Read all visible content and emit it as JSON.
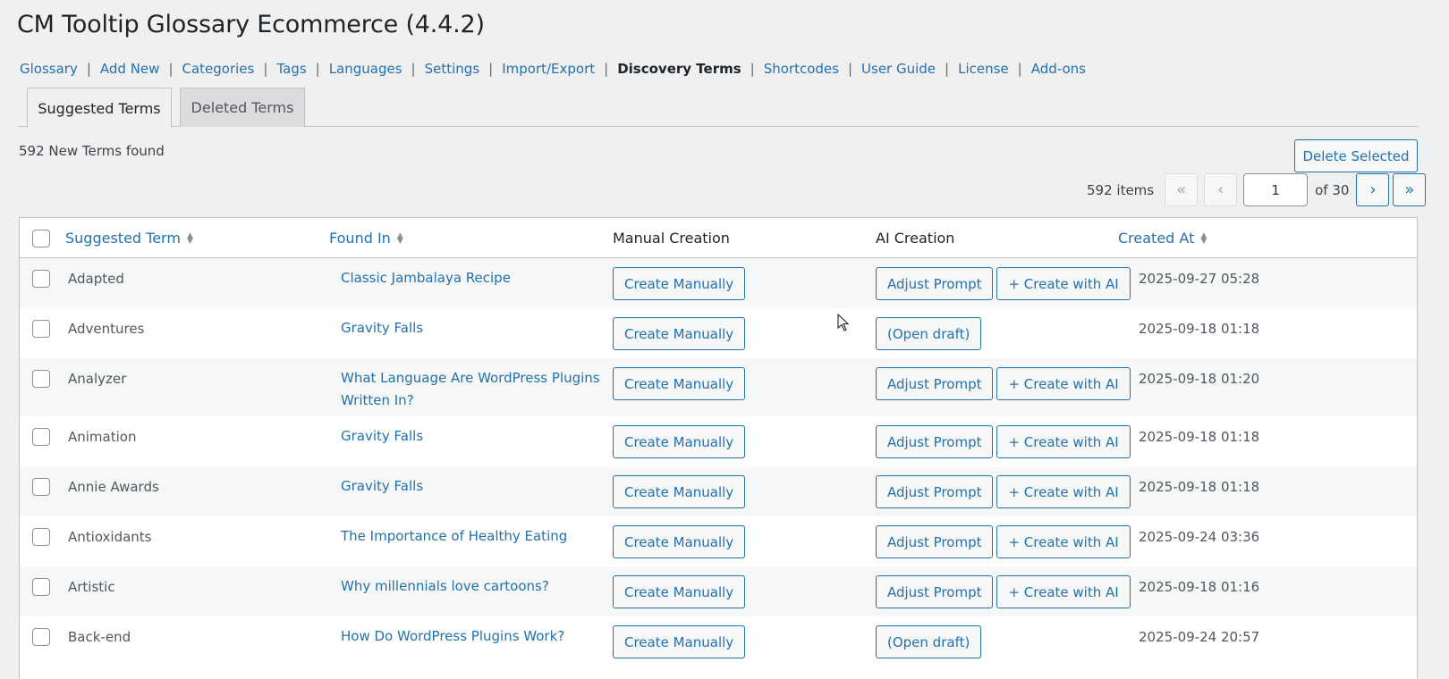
{
  "page": {
    "title": "CM Tooltip Glossary Ecommerce (4.4.2)"
  },
  "subnav": [
    {
      "label": "Glossary",
      "current": false
    },
    {
      "label": "Add New",
      "current": false
    },
    {
      "label": "Categories",
      "current": false
    },
    {
      "label": "Tags",
      "current": false
    },
    {
      "label": "Languages",
      "current": false
    },
    {
      "label": "Settings",
      "current": false
    },
    {
      "label": "Import/Export",
      "current": false
    },
    {
      "label": "Discovery Terms",
      "current": true
    },
    {
      "label": "Shortcodes",
      "current": false
    },
    {
      "label": "User Guide",
      "current": false
    },
    {
      "label": "License",
      "current": false
    },
    {
      "label": "Add-ons",
      "current": false
    }
  ],
  "tabs": {
    "suggested": "Suggested Terms",
    "deleted": "Deleted Terms"
  },
  "found_count": "592 New Terms found",
  "delete_selected_label": "Delete Selected",
  "pagination": {
    "items": "592 items",
    "first": "«",
    "prev": "‹",
    "next": "›",
    "last": "»",
    "current_page": "1",
    "of_total": "of 30"
  },
  "table": {
    "columns": {
      "term": "Suggested Term",
      "found": "Found In",
      "manual": "Manual Creation",
      "ai": "AI Creation",
      "created": "Created At"
    },
    "rows": [
      {
        "term": "Adapted",
        "found": "Classic Jambalaya Recipe",
        "manual": "Create Manually",
        "ai": [
          "Adjust Prompt",
          "+ Create with AI"
        ],
        "created": "2025-09-27 05:28"
      },
      {
        "term": "Adventures",
        "found": "Gravity Falls",
        "manual": "Create Manually",
        "ai": [
          "(Open draft)"
        ],
        "created": "2025-09-18 01:18"
      },
      {
        "term": "Analyzer",
        "found": "What Language Are WordPress Plugins Written In?",
        "manual": "Create Manually",
        "ai": [
          "Adjust Prompt",
          "+ Create with AI"
        ],
        "created": "2025-09-18 01:20"
      },
      {
        "term": "Animation",
        "found": "Gravity Falls",
        "manual": "Create Manually",
        "ai": [
          "Adjust Prompt",
          "+ Create with AI"
        ],
        "created": "2025-09-18 01:18"
      },
      {
        "term": "Annie Awards",
        "found": "Gravity Falls",
        "manual": "Create Manually",
        "ai": [
          "Adjust Prompt",
          "+ Create with AI"
        ],
        "created": "2025-09-18 01:18"
      },
      {
        "term": "Antioxidants",
        "found": "The Importance of Healthy Eating",
        "manual": "Create Manually",
        "ai": [
          "Adjust Prompt",
          "+ Create with AI"
        ],
        "created": "2025-09-24 03:36"
      },
      {
        "term": "Artistic",
        "found": "Why millennials love cartoons?",
        "manual": "Create Manually",
        "ai": [
          "Adjust Prompt",
          "+ Create with AI"
        ],
        "created": "2025-09-18 01:16"
      },
      {
        "term": "Back-end",
        "found": "How Do WordPress Plugins Work?",
        "manual": "Create Manually",
        "ai": [
          "(Open draft)"
        ],
        "created": "2025-09-24 20:57"
      }
    ]
  }
}
